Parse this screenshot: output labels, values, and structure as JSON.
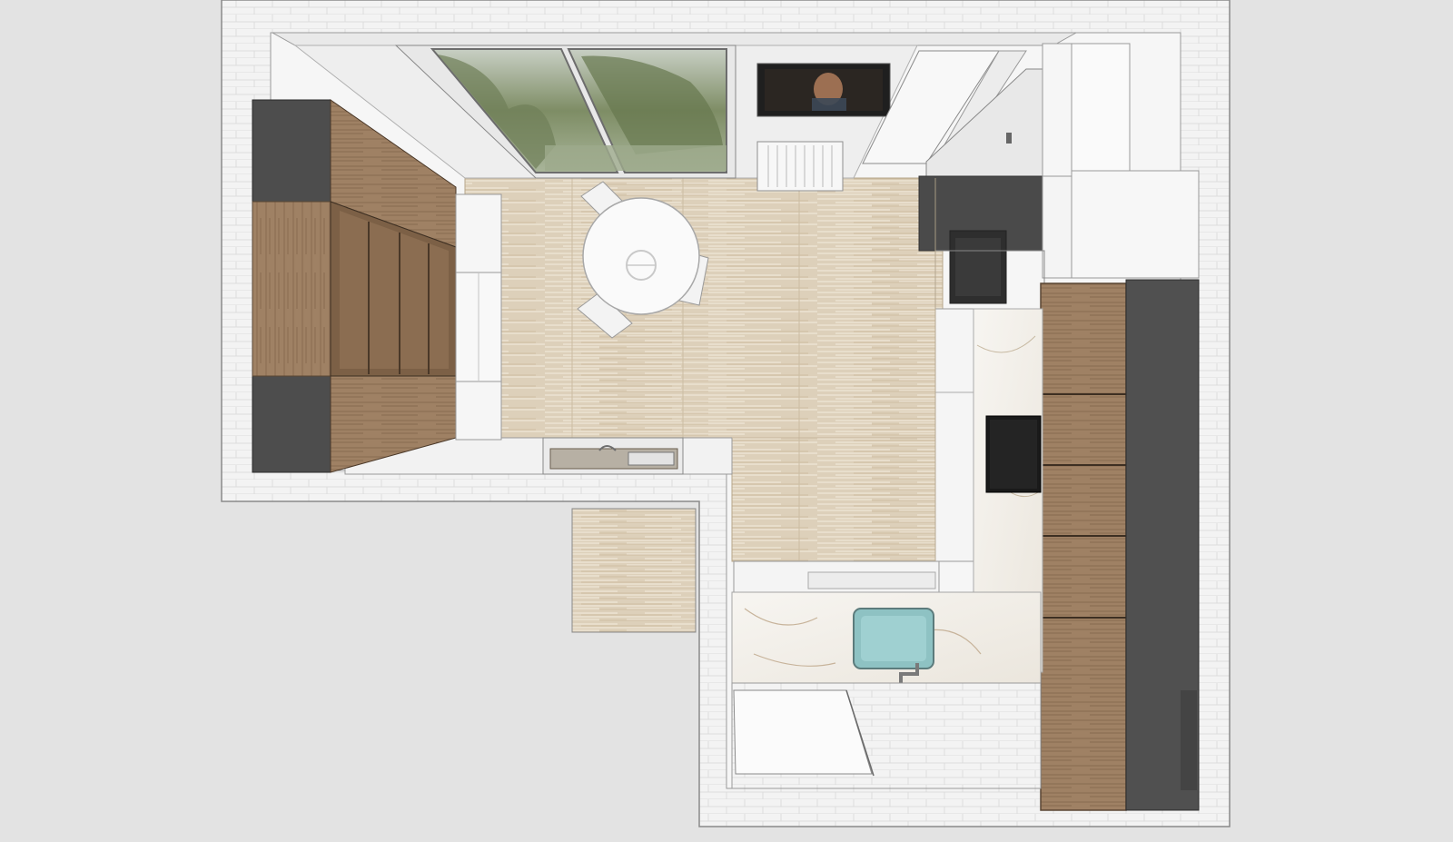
{
  "scene": {
    "kind": "top-down kitchen floor plan render",
    "colors": {
      "background": "#e3e3e3",
      "wall": "#f2f2f2",
      "wall_edge": "#8a8a8a",
      "floor_wood": "#dccfb8",
      "oak": "#9e8062",
      "oak_dark": "#7e6248",
      "graphite": "#505050",
      "white_cabinet": "#f7f7f7",
      "marble": "#f4f1ec",
      "sink_glass": "#8fc3c4",
      "tv_screen": "#1e1e1e"
    },
    "icons": {
      "sink": "sink-icon",
      "faucet": "faucet-icon",
      "cooktop": "cooktop-icon",
      "window": "window-icon",
      "tv": "tv-icon",
      "radiator": "radiator-icon",
      "table": "dining-table-icon",
      "chair": "chair-icon"
    }
  }
}
